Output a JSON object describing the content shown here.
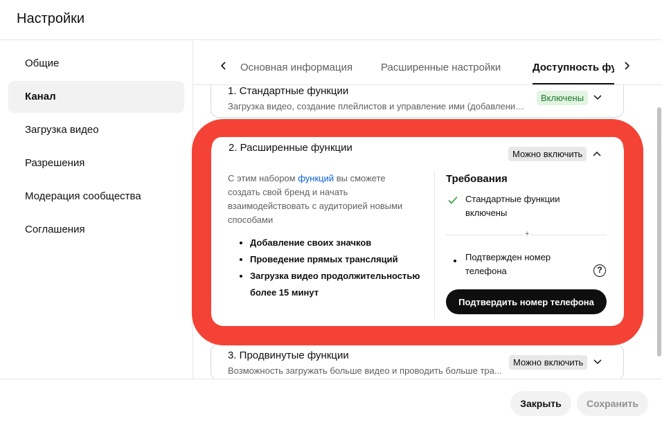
{
  "dialog": {
    "title": "Настройки"
  },
  "sidebar": {
    "items": [
      {
        "label": "Общие",
        "active": false
      },
      {
        "label": "Канал",
        "active": true
      },
      {
        "label": "Загрузка видео",
        "active": false
      },
      {
        "label": "Разрешения",
        "active": false
      },
      {
        "label": "Модерация сообщества",
        "active": false
      },
      {
        "label": "Соглашения",
        "active": false
      }
    ]
  },
  "tabs": {
    "items": [
      {
        "label": "Основная информация"
      },
      {
        "label": "Расширенные настройки"
      },
      {
        "label": "Доступность функций",
        "active": true
      }
    ],
    "prev_icon": "chevron-left-icon",
    "next_icon": "chevron-right-icon"
  },
  "features": {
    "standard": {
      "title": "1. Стандартные функции",
      "subtitle": "Загрузка видео, создание плейлистов и управление ими (добавление ...",
      "status": "Включены"
    },
    "advanced": {
      "title": "2. Расширенные функции",
      "status": "Можно включить",
      "desc_before": "С этим набором ",
      "desc_link": "функций",
      "desc_after": " вы сможете создать свой бренд и начать взаимодействовать с аудиторией новыми способами",
      "list": [
        "Добавление своих значков",
        "Проведение прямых трансляций",
        "Загрузка видео продолжительностью более 15 минут"
      ],
      "requirements_title": "Требования",
      "req_done": "Стандартные функции включены",
      "plus": "+",
      "req_pending": "Подтвержден номер телефона",
      "verify_button": "Подтвердить номер телефона"
    },
    "pro": {
      "title": "3. Продвинутые функции",
      "subtitle": "Возможность загружать больше видео и проводить больше тра...",
      "status": "Можно включить"
    }
  },
  "footer": {
    "close_label": "Закрыть",
    "save_label": "Сохранить"
  },
  "colors": {
    "highlight": "#f44336",
    "enabled_badge_bg": "#e3f4e2",
    "enabled_badge_text": "#1b7a2b",
    "link": "#065fd4"
  }
}
